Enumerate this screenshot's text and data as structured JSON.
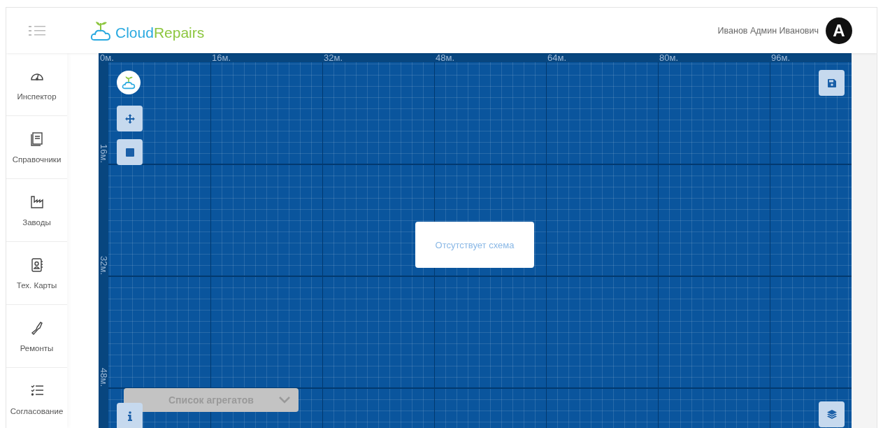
{
  "header": {
    "brand_parts": [
      "Cloud",
      "Repairs"
    ],
    "user_name": "Иванов Админ Иванович",
    "avatar_letter": "A"
  },
  "sidebar": {
    "items": [
      {
        "label": "Инспектор"
      },
      {
        "label": "Справочники"
      },
      {
        "label": "Заводы"
      },
      {
        "label": "Тех. Карты"
      },
      {
        "label": "Ремонты"
      },
      {
        "label": "Согласование"
      }
    ]
  },
  "canvas": {
    "x_ruler": [
      "0м.",
      "16м.",
      "32м.",
      "48м.",
      "64м.",
      "80м.",
      "96м."
    ],
    "y_ruler": [
      "16м.",
      "32м.",
      "48м."
    ],
    "empty_message": "Отсутствует схема",
    "units_dropdown": {
      "placeholder": "Список агрегатов"
    }
  }
}
